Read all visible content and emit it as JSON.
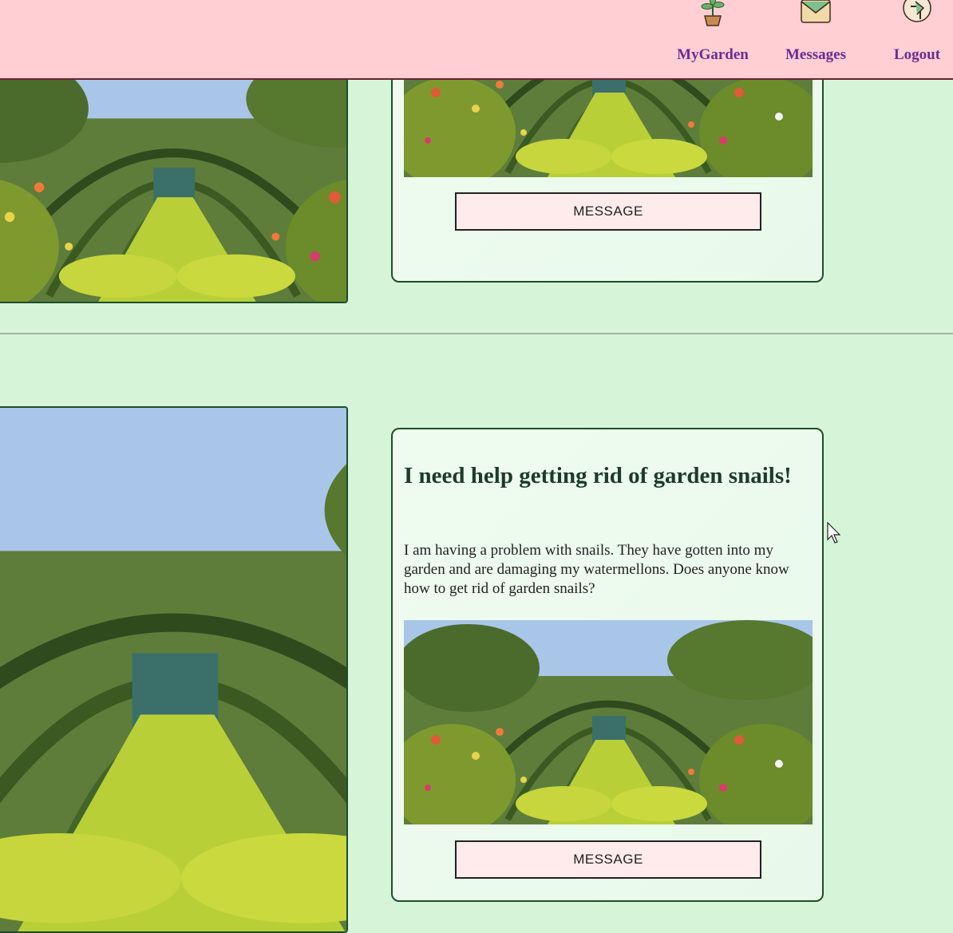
{
  "nav": {
    "items": [
      {
        "label": "MyGarden",
        "icon": "potted-plant-icon"
      },
      {
        "label": "Messages",
        "icon": "envelope-icon"
      },
      {
        "label": "Logout",
        "icon": "door-exit-icon"
      }
    ]
  },
  "posts": [
    {
      "title": "",
      "body": "",
      "button_label": "MESSAGE"
    },
    {
      "title": "I need help getting rid of garden snails!",
      "body": "I am having a problem with snails. They have gotten into my garden and are damaging my watermellons. Does anyone know how to get rid of garden snails?",
      "button_label": "MESSAGE"
    }
  ],
  "colors": {
    "header_bg": "#ffcfd4",
    "nav_text": "#6a2d8f",
    "page_bg": "#d6f5d8",
    "card_border": "#1d4d2a",
    "button_bg": "#ffeaec"
  }
}
